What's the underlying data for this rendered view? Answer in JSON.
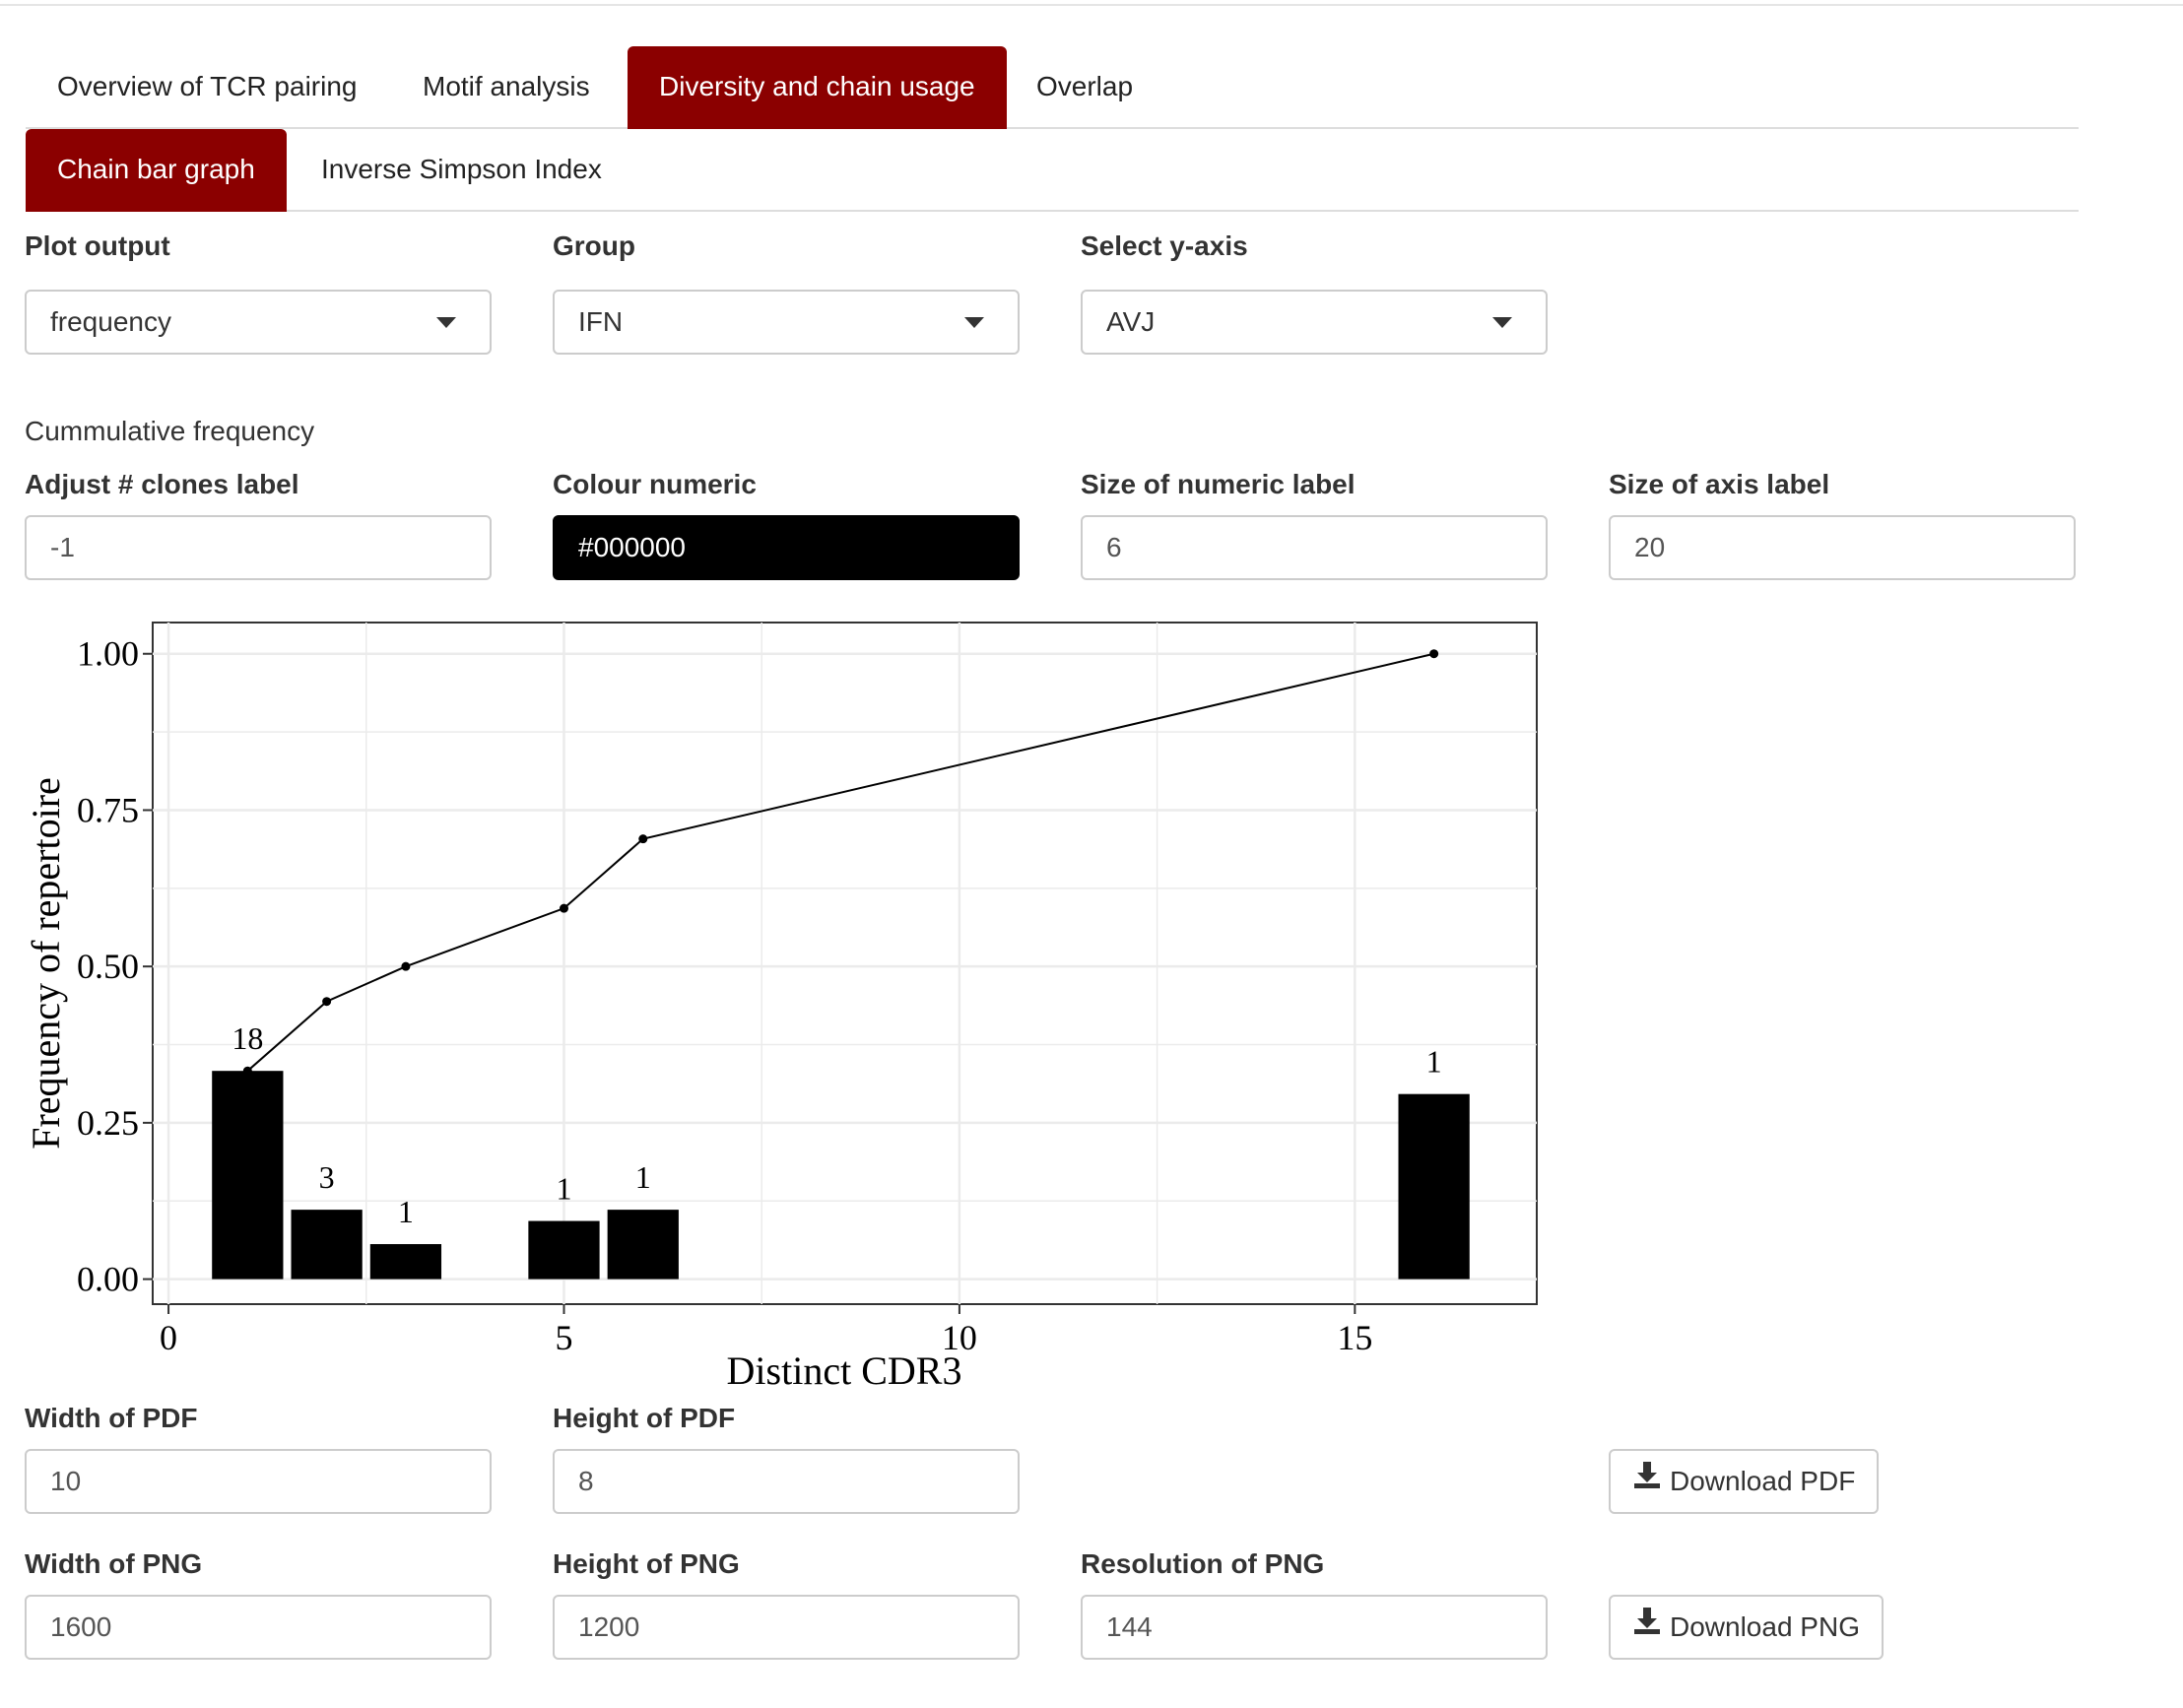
{
  "tabs_main": [
    {
      "label": "Overview of TCR pairing",
      "active": false
    },
    {
      "label": "Motif analysis",
      "active": false
    },
    {
      "label": "Diversity and chain usage",
      "active": true
    },
    {
      "label": "Overlap",
      "active": false
    }
  ],
  "tabs_sub": [
    {
      "label": "Chain bar graph",
      "active": true
    },
    {
      "label": "Inverse Simpson Index",
      "active": false
    }
  ],
  "controls": {
    "plot_output": {
      "label": "Plot output",
      "value": "frequency"
    },
    "group": {
      "label": "Group",
      "value": "IFN"
    },
    "y_axis": {
      "label": "Select y-axis",
      "value": "AVJ"
    },
    "cumulative_label": "Cummulative frequency",
    "adjust_clones": {
      "label": "Adjust # clones label",
      "value": "-1"
    },
    "colour_numeric": {
      "label": "Colour numeric",
      "value": "#000000"
    },
    "size_numeric": {
      "label": "Size of numeric label",
      "value": "6"
    },
    "size_axis": {
      "label": "Size of axis label",
      "value": "20"
    }
  },
  "export": {
    "pdf_width": {
      "label": "Width of PDF",
      "value": "10"
    },
    "pdf_height": {
      "label": "Height of PDF",
      "value": "8"
    },
    "download_pdf": "Download PDF",
    "png_width": {
      "label": "Width of PNG",
      "value": "1600"
    },
    "png_height": {
      "label": "Height of PNG",
      "value": "1200"
    },
    "png_res": {
      "label": "Resolution of PNG",
      "value": "144"
    },
    "download_png": "Download PNG"
  },
  "colors": {
    "accent": "#8b0000",
    "bar": "#000000",
    "grid": "#ebebeb"
  },
  "chart_data": {
    "type": "bar",
    "xlabel": "Distinct CDR3",
    "ylabel": "Frequency of repertoire",
    "xlim": [
      -0.2,
      17.3
    ],
    "ylim": [
      -0.04,
      1.05
    ],
    "x_ticks": [
      0,
      5,
      10,
      15
    ],
    "y_ticks": [
      0.0,
      0.25,
      0.5,
      0.75,
      1.0
    ],
    "y_tick_labels": [
      "0.00",
      "0.25",
      "0.50",
      "0.75",
      "1.00"
    ],
    "grid": true,
    "bars": [
      {
        "x": 1,
        "y": 0.333,
        "label": "18"
      },
      {
        "x": 2,
        "y": 0.111,
        "label": "3"
      },
      {
        "x": 3,
        "y": 0.056,
        "label": "1"
      },
      {
        "x": 5,
        "y": 0.093,
        "label": "1"
      },
      {
        "x": 6,
        "y": 0.111,
        "label": "1"
      },
      {
        "x": 16,
        "y": 0.296,
        "label": "1"
      }
    ],
    "cumulative_line": [
      {
        "x": 1,
        "y": 0.333
      },
      {
        "x": 2,
        "y": 0.444
      },
      {
        "x": 3,
        "y": 0.5
      },
      {
        "x": 5,
        "y": 0.593
      },
      {
        "x": 6,
        "y": 0.704
      },
      {
        "x": 16,
        "y": 1.0
      }
    ]
  }
}
